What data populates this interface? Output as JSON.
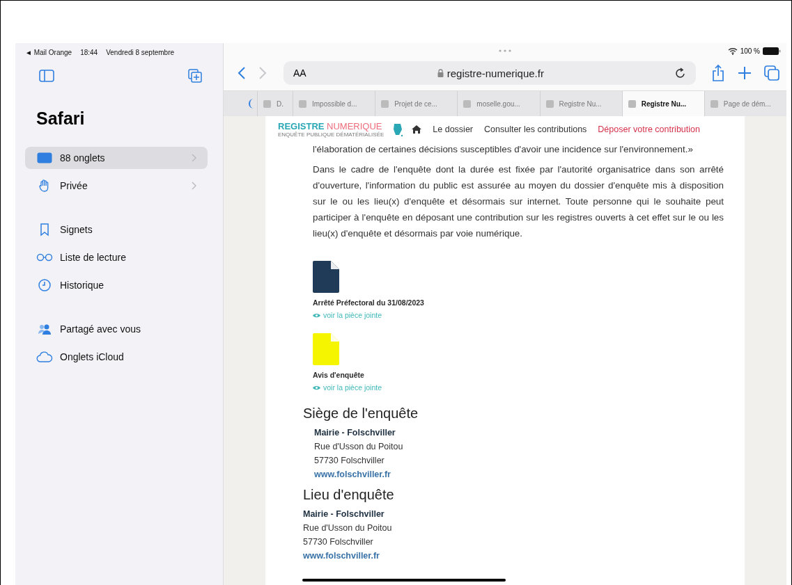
{
  "status_bar": {
    "back_app": "◄ Mail Orange",
    "time": "18:44",
    "date": "Vendredi 8 septembre",
    "battery": "100 %"
  },
  "sidebar": {
    "title": "Safari",
    "groups": [
      [
        {
          "label": "88 onglets",
          "kind": "tabs",
          "selected": true,
          "has_chevron": true
        },
        {
          "label": "Privée",
          "kind": "private",
          "selected": false,
          "has_chevron": true
        }
      ],
      [
        {
          "label": "Signets",
          "kind": "bookmarks",
          "selected": false,
          "has_chevron": false
        },
        {
          "label": "Liste de lecture",
          "kind": "reading",
          "selected": false,
          "has_chevron": false
        },
        {
          "label": "Historique",
          "kind": "history",
          "selected": false,
          "has_chevron": false
        }
      ],
      [
        {
          "label": "Partagé avec vous",
          "kind": "shared",
          "selected": false,
          "has_chevron": false
        },
        {
          "label": "Onglets iCloud",
          "kind": "cloud",
          "selected": false,
          "has_chevron": false
        }
      ]
    ]
  },
  "toolbar": {
    "text_size": "AA",
    "url": "registre-numerique.fr"
  },
  "tabs": [
    {
      "label": "D.",
      "selected": false
    },
    {
      "label": "Impossible d...",
      "selected": false
    },
    {
      "label": "Projet de ce...",
      "selected": false
    },
    {
      "label": "moselle.gou...",
      "selected": false
    },
    {
      "label": "Registre Nu...",
      "selected": false
    },
    {
      "label": "Registre Nu...",
      "selected": true
    },
    {
      "label": "Page de dém...",
      "selected": false
    }
  ],
  "site_header": {
    "logo_word_1": "REGISTRE",
    "logo_word_2": "NUMERIQUE",
    "tagline": "ENQUÊTE PUBLIQUE DÉMATÉRIALISÉE",
    "nav": [
      {
        "label": "Le dossier",
        "kind": "normal"
      },
      {
        "label": "Consulter les contributions",
        "kind": "normal"
      },
      {
        "label": "Déposer votre contribution",
        "kind": "accent"
      }
    ]
  },
  "paragraphs": [
    "l'élaboration de certaines décisions susceptibles d'avoir une incidence sur l'environnement.»",
    "Dans le cadre de l'enquête dont la durée est fixée par l'autorité organisatrice dans son arrêté d'ouverture, l'information du public est assurée au moyen du dossier d'enquête mis à disposition sur le ou les lieu(x) d'enquête et désormais sur internet. Toute personne qui le souhaite peut participer à l'enquête en déposant une contribution sur les registres ouverts à cet effet sur le ou les lieu(x) d'enquête et désormais par voie numérique."
  ],
  "documents": [
    {
      "title": "Arrêté Préfectoral du 31/08/2023",
      "link": "voir la pièce jointe",
      "color": "#1f3b57"
    },
    {
      "title": "Avis d'enquête",
      "link": "voir la pièce jointe",
      "color": "#f5f500"
    }
  ],
  "places": [
    {
      "heading": "Siège de l'enquête",
      "name": "Mairie - Folschviller",
      "street": "Rue d'Usson du Poitou",
      "city": "57730 Folschviller",
      "website": "www.folschviller.fr"
    },
    {
      "heading": "Lieu d'enquête",
      "name": "Mairie - Folschviller",
      "street": "Rue d'Usson du Poitou",
      "city": "57730 Folschviller",
      "website": "www.folschviller.fr"
    }
  ]
}
